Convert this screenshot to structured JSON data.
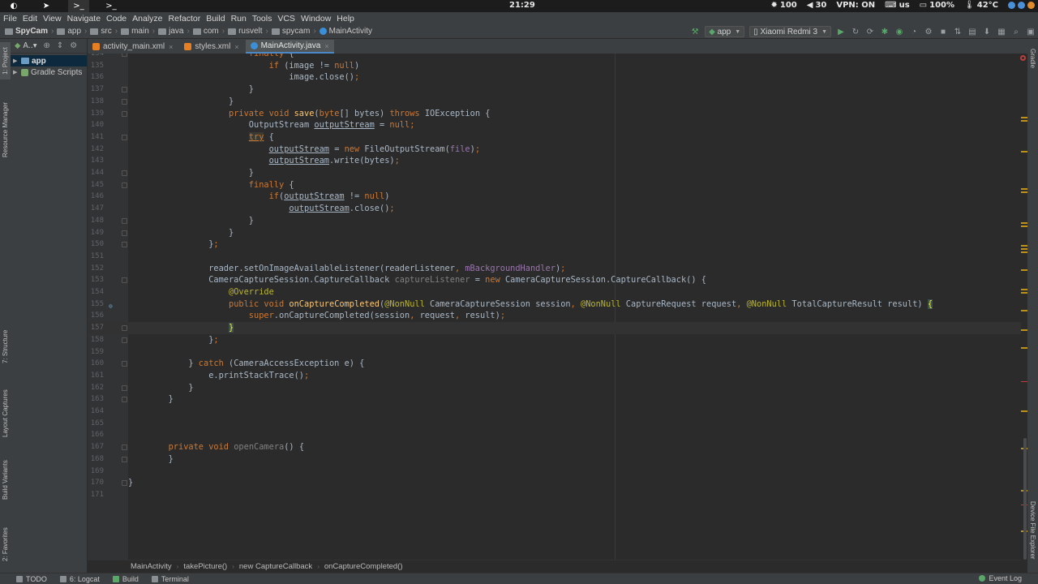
{
  "system_bar": {
    "clock": "21:29",
    "brightness": "100",
    "volume": "30",
    "vpn": "VPN: ON",
    "keyboard": "us",
    "battery": "100%",
    "temperature": "42°C"
  },
  "menu": {
    "items": [
      "File",
      "Edit",
      "View",
      "Navigate",
      "Code",
      "Analyze",
      "Refactor",
      "Build",
      "Run",
      "Tools",
      "VCS",
      "Window",
      "Help"
    ]
  },
  "navbar": {
    "crumbs": [
      "SpyCam",
      "app",
      "src",
      "main",
      "java",
      "com",
      "rusvelt",
      "spycam",
      "MainActivity"
    ],
    "run_config": "app",
    "device": "Xiaomi Redmi 3"
  },
  "project_panel": {
    "view_mode": "A..▾",
    "tree": [
      {
        "label": "app",
        "selected": true
      },
      {
        "label": "Gradle Scripts",
        "selected": false
      }
    ]
  },
  "left_strip": {
    "project": "1: Project",
    "resource_manager": "Resource Manager",
    "structure": "7: Structure",
    "layout_captures": "Layout Captures",
    "build_variants": "Build Variants",
    "favorites": "2: Favorites"
  },
  "right_strip": {
    "gradle": "Gradle",
    "device_file_explorer": "Device File Explorer"
  },
  "tabs": [
    {
      "label": "activity_main.xml",
      "active": false,
      "color": "#e67e22"
    },
    {
      "label": "styles.xml",
      "active": false,
      "color": "#e67e22"
    },
    {
      "label": "MainActivity.java",
      "active": true,
      "color": "#3b8fd6"
    }
  ],
  "editor": {
    "current_line": "157",
    "lines": [
      {
        "n": "134",
        "html": "                        <span class=\"k\">finally</span> {"
      },
      {
        "n": "135",
        "html": "                            <span class=\"k\">if</span> (image != <span class=\"k\">null</span>)"
      },
      {
        "n": "136",
        "html": "                                image.close()<span class=\"k\">;</span>"
      },
      {
        "n": "137",
        "html": "                        }"
      },
      {
        "n": "138",
        "html": "                    }"
      },
      {
        "n": "139",
        "html": "                    <span class=\"k\">private void</span> <span class=\"m\">save</span>(<span class=\"k\">byte</span>[] bytes) <span class=\"k\">throws</span> IOException {"
      },
      {
        "n": "140",
        "html": "                        OutputStream <span class=\"u\">outputStream</span> = <span class=\"k\">null;</span>"
      },
      {
        "n": "141",
        "html": "                        <span class=\"tryhl\">try</span> {"
      },
      {
        "n": "142",
        "html": "                            <span class=\"u\">outputStream</span> = <span class=\"k\">new</span> FileOutputStream(<span class=\"f\">file</span>)<span class=\"k\">;</span>"
      },
      {
        "n": "143",
        "html": "                            <span class=\"u\">outputStream</span>.write(bytes)<span class=\"k\">;</span>"
      },
      {
        "n": "144",
        "html": "                        }"
      },
      {
        "n": "145",
        "html": "                        <span class=\"k\">finally</span> {"
      },
      {
        "n": "146",
        "html": "                            <span class=\"k\">if</span>(<span class=\"u\">outputStream</span> != <span class=\"k\">null</span>)"
      },
      {
        "n": "147",
        "html": "                                <span class=\"u\">outputStream</span>.close()<span class=\"k\">;</span>"
      },
      {
        "n": "148",
        "html": "                        }"
      },
      {
        "n": "149",
        "html": "                    }"
      },
      {
        "n": "150",
        "html": "                }<span class=\"k\">;</span>"
      },
      {
        "n": "151",
        "html": ""
      },
      {
        "n": "152",
        "html": "                reader.setOnImageAvailableListener(readerListener<span class=\"k\">,</span> <span class=\"f\">mBackgroundHandler</span>)<span class=\"k\">;</span>"
      },
      {
        "n": "153",
        "html": "                CameraCaptureSession.CaptureCallback <span class=\"gr\">captureListener</span> = <span class=\"k\">new</span> CameraCaptureSession.CaptureCallback() {"
      },
      {
        "n": "154",
        "html": "                    <span class=\"a\">@Override</span>"
      },
      {
        "n": "155",
        "html": "                    <span class=\"k\">public void</span> <span class=\"m\">onCaptureCompleted</span>(<span class=\"a\">@NonNull</span> CameraCaptureSession session<span class=\"k\">,</span> <span class=\"a\">@NonNull</span> CaptureRequest request<span class=\"k\">,</span> <span class=\"a\">@NonNull</span> TotalCaptureResult result) <span class=\"bhl\">{</span>"
      },
      {
        "n": "156",
        "html": "                        <span class=\"k\">super</span>.onCaptureCompleted(session<span class=\"k\">,</span> request<span class=\"k\">,</span> result)<span class=\"k\">;</span>"
      },
      {
        "n": "157",
        "html": "                    <span class=\"bhl\">}</span>"
      },
      {
        "n": "158",
        "html": "                }<span class=\"k\">;</span>"
      },
      {
        "n": "159",
        "html": ""
      },
      {
        "n": "160",
        "html": "            } <span class=\"k\">catch</span> (CameraAccessException e) {"
      },
      {
        "n": "161",
        "html": "                e.printStackTrace()<span class=\"k\">;</span>"
      },
      {
        "n": "162",
        "html": "            }"
      },
      {
        "n": "163",
        "html": "        }"
      },
      {
        "n": "164",
        "html": ""
      },
      {
        "n": "165",
        "html": ""
      },
      {
        "n": "166",
        "html": ""
      },
      {
        "n": "167",
        "html": "        <span class=\"k\">private void</span> <span class=\"gr\">openCamera</span>() {"
      },
      {
        "n": "168",
        "html": "        }"
      },
      {
        "n": "169",
        "html": ""
      },
      {
        "n": "170",
        "html": "}"
      },
      {
        "n": "171",
        "html": ""
      }
    ]
  },
  "breadcrumb": [
    "MainActivity",
    "takePicture()",
    "new CaptureCallback",
    "onCaptureCompleted()"
  ],
  "bottom_bar": {
    "todo": "TODO",
    "logcat": "6: Logcat",
    "build": "Build",
    "terminal": "Terminal",
    "event_log": "Event Log"
  },
  "colors": {
    "editor_bg": "#2b2b2b",
    "panel_bg": "#3c3f41",
    "keyword": "#cc7832",
    "method": "#ffc66d",
    "field": "#9876aa",
    "annotation": "#bbb529"
  }
}
